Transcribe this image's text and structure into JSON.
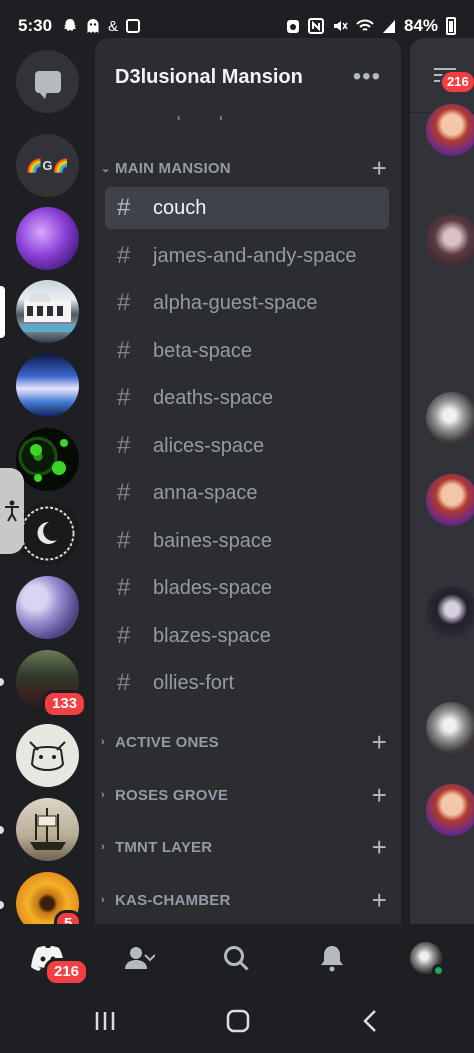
{
  "status_bar": {
    "time": "5:30",
    "left_icons": [
      "snapchat-icon",
      "ghost-icon",
      "ampersand",
      "instagram-icon"
    ],
    "ampersand": "&",
    "right_icons": [
      "alarm-icon",
      "nfc-icon",
      "mute-icon",
      "wifi-icon",
      "signal-icon"
    ],
    "battery": "84%"
  },
  "server_rail": {
    "servers": [
      {
        "name": "direct-messages",
        "type": "dm"
      },
      {
        "name": "rainbow-g-server",
        "label": "🌈G🌈"
      },
      {
        "name": "purple-sparkle-server"
      },
      {
        "name": "mansion-server",
        "selected": true
      },
      {
        "name": "galaxy-server"
      },
      {
        "name": "green-eyes-server"
      },
      {
        "name": "crescent-logo-server"
      },
      {
        "name": "flowers-server"
      },
      {
        "name": "crowd-server",
        "badge": "133"
      },
      {
        "name": "fox-sketch-server"
      },
      {
        "name": "ship-server"
      },
      {
        "name": "sunflower-server",
        "badge": "5"
      }
    ]
  },
  "panel": {
    "server_name": "D3lusional Mansion",
    "more_label": "•••",
    "partial_channel": "temp-help",
    "categories": [
      {
        "label": "MAIN MANSION",
        "expanded": true
      },
      {
        "label": "ACTIVE ONES",
        "expanded": false
      },
      {
        "label": "ROSES GROVE",
        "expanded": false
      },
      {
        "label": "TMNT LAYER",
        "expanded": false
      },
      {
        "label": "KAS-CHAMBER",
        "expanded": false
      }
    ],
    "channels": [
      {
        "label": "couch",
        "active": true
      },
      {
        "label": "james-and-andy-space"
      },
      {
        "label": "alpha-guest-space"
      },
      {
        "label": "beta-space"
      },
      {
        "label": "deaths-space"
      },
      {
        "label": "alices-space"
      },
      {
        "label": "anna-space"
      },
      {
        "label": "baines-space"
      },
      {
        "label": "blades-space"
      },
      {
        "label": "blazes-space"
      },
      {
        "label": "ollies-fort"
      }
    ],
    "hash_symbol": "#",
    "plus_symbol": "+"
  },
  "content": {
    "badge": "216"
  },
  "bottom_nav": {
    "home_badge": "216",
    "items": [
      "home-icon",
      "friends-icon",
      "search-icon",
      "notifications-icon",
      "profile-avatar"
    ]
  },
  "colors": {
    "background": "#1e1f22",
    "panel": "#2b2d31",
    "active_channel": "#404249",
    "badge_red": "#f23f43",
    "online_green": "#23a55a"
  }
}
